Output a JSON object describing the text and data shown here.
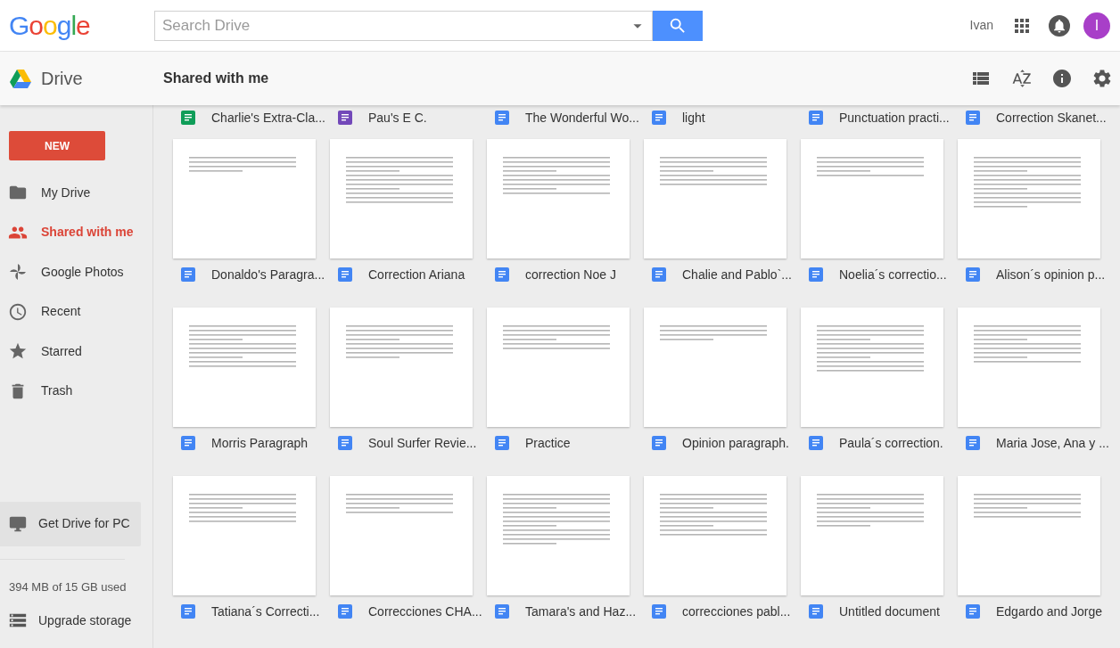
{
  "header": {
    "logo": "Google",
    "search": {
      "placeholder": "Search Drive"
    },
    "user_name": "Ivan",
    "avatar_initial": "I"
  },
  "subheader": {
    "app_name": "Drive",
    "title": "Shared with me"
  },
  "sidebar": {
    "new_button": "NEW",
    "items": [
      {
        "label": "My Drive",
        "selected": false
      },
      {
        "label": "Shared with me",
        "selected": true
      },
      {
        "label": "Google Photos",
        "selected": false
      },
      {
        "label": "Recent",
        "selected": false
      },
      {
        "label": "Starred",
        "selected": false
      },
      {
        "label": "Trash",
        "selected": false
      }
    ],
    "get_drive": "Get Drive for PC",
    "storage": "394 MB of 15 GB used",
    "upgrade": "Upgrade storage"
  },
  "partial_row": [
    {
      "name": "Charlie's Extra-Cla...",
      "kind": "sheet"
    },
    {
      "name": "Pau's E C.",
      "kind": "form"
    },
    {
      "name": "The Wonderful Wo...",
      "kind": "doc"
    },
    {
      "name": "light",
      "kind": "doc"
    },
    {
      "name": "Punctuation practi...",
      "kind": "doc"
    },
    {
      "name": "Correction Skanet...",
      "kind": "doc"
    }
  ],
  "files": [
    {
      "name": "Donaldo's Paragra...",
      "kind": "doc"
    },
    {
      "name": "Correction Ariana",
      "kind": "doc"
    },
    {
      "name": "correction Noe J",
      "kind": "doc"
    },
    {
      "name": "Chalie and Pablo`...",
      "kind": "doc"
    },
    {
      "name": "Noelia´s correctio...",
      "kind": "doc"
    },
    {
      "name": "Alison´s opinion p...",
      "kind": "doc"
    },
    {
      "name": "Morris Paragraph",
      "kind": "doc"
    },
    {
      "name": "Soul Surfer Revie...",
      "kind": "doc"
    },
    {
      "name": "Practice",
      "kind": "doc"
    },
    {
      "name": "Opinion paragraph.",
      "kind": "doc"
    },
    {
      "name": "Paula´s correction.",
      "kind": "doc"
    },
    {
      "name": "Maria Jose, Ana y ...",
      "kind": "doc"
    },
    {
      "name": "Tatiana´s Correcti...",
      "kind": "doc"
    },
    {
      "name": "Correcciones CHA...",
      "kind": "doc"
    },
    {
      "name": "Tamara's and Haz...",
      "kind": "doc"
    },
    {
      "name": "correcciones pabl...",
      "kind": "doc"
    },
    {
      "name": "Untitled document",
      "kind": "doc"
    },
    {
      "name": "Edgardo and Jorge",
      "kind": "doc"
    }
  ]
}
